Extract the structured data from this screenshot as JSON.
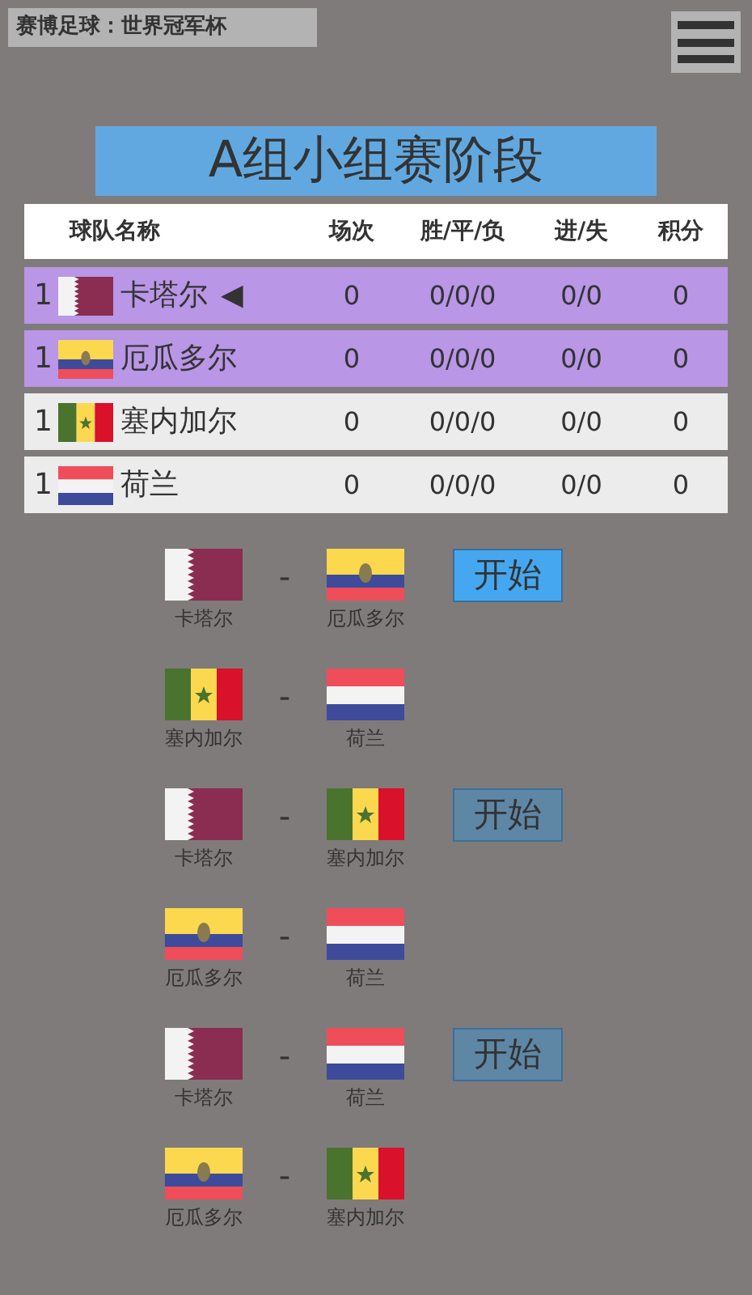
{
  "app_title": "赛博足球：世界冠军杯",
  "group_title": "A组小组赛阶段",
  "table": {
    "columns": [
      "球队名称",
      "场次",
      "胜/平/负",
      "进/失",
      "积分"
    ],
    "rows": [
      {
        "rank": "1",
        "kind": "qatar",
        "team": "卡塔尔",
        "marker": "◀",
        "played": "0",
        "wdl": "0/0/0",
        "goals": "0/0",
        "points": "0",
        "highlighted": true
      },
      {
        "rank": "1",
        "kind": "ecuador",
        "team": "厄瓜多尔",
        "played": "0",
        "wdl": "0/0/0",
        "goals": "0/0",
        "points": "0",
        "highlighted": true
      },
      {
        "rank": "1",
        "kind": "senegal",
        "team": "塞内加尔",
        "played": "0",
        "wdl": "0/0/0",
        "goals": "0/0",
        "points": "0",
        "highlighted": false
      },
      {
        "rank": "1",
        "kind": "netherlands",
        "team": "荷兰",
        "played": "0",
        "wdl": "0/0/0",
        "goals": "0/0",
        "points": "0",
        "highlighted": false
      }
    ]
  },
  "matches": [
    {
      "home": {
        "kind": "qatar",
        "name": "卡塔尔"
      },
      "separator": "-",
      "away": {
        "kind": "ecuador",
        "name": "厄瓜多尔"
      },
      "button": {
        "label": "开始",
        "disabled": false
      }
    },
    {
      "home": {
        "kind": "senegal",
        "name": "塞内加尔"
      },
      "separator": "-",
      "away": {
        "kind": "netherlands",
        "name": "荷兰"
      }
    },
    {
      "home": {
        "kind": "qatar",
        "name": "卡塔尔"
      },
      "separator": "-",
      "away": {
        "kind": "senegal",
        "name": "塞内加尔"
      },
      "button": {
        "label": "开始",
        "disabled": true
      }
    },
    {
      "home": {
        "kind": "ecuador",
        "name": "厄瓜多尔"
      },
      "separator": "-",
      "away": {
        "kind": "netherlands",
        "name": "荷兰"
      }
    },
    {
      "home": {
        "kind": "qatar",
        "name": "卡塔尔"
      },
      "separator": "-",
      "away": {
        "kind": "netherlands",
        "name": "荷兰"
      },
      "button": {
        "label": "开始",
        "disabled": true
      }
    },
    {
      "home": {
        "kind": "ecuador",
        "name": "厄瓜多尔"
      },
      "separator": "-",
      "away": {
        "kind": "senegal",
        "name": "塞内加尔"
      }
    }
  ]
}
